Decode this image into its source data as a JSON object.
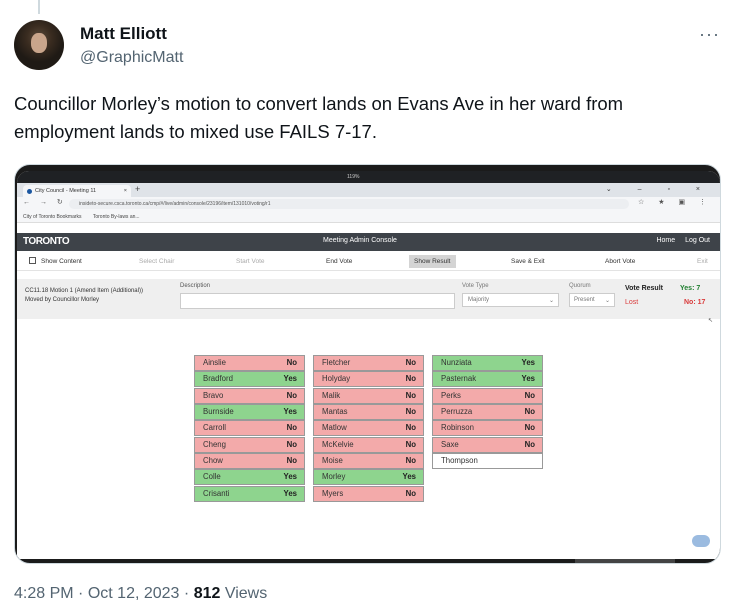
{
  "tweet": {
    "author_name": "Matt Elliott",
    "handle": "@GraphicMatt",
    "more_label": "···",
    "text": "Councillor Morley’s motion to convert lands on Evans Ave in her ward from employment lands to mixed use FAILS 7-17.",
    "time": "4:28 PM",
    "separator": "·",
    "date": "Oct 12, 2023",
    "views_count": "812",
    "views_label": "Views"
  },
  "browser": {
    "tab_label": "City Council - Meeting 11",
    "zoom": "119%",
    "url": "insideto-secure.csca.toronto.ca/cmp/#/live/admin/console/23196/item/131010/voting/r1",
    "bookmarks": [
      "City of Toronto Bookmarks",
      "Toronto By-laws an..."
    ]
  },
  "app": {
    "logo": "TORONTO",
    "title": "Meeting Admin Console",
    "links": [
      "Home",
      "Log Out"
    ],
    "toolbar": {
      "show_content": "Show Content",
      "select_chair": "Select Chair",
      "start_vote": "Start Vote",
      "end_vote": "End Vote",
      "show_result": "Show Result",
      "save_exit": "Save & Exit",
      "abort_vote": "Abort Vote",
      "exit": "Exit"
    },
    "motion": {
      "id_line": "CC11.18 Motion 1 (Amend Item (Additional))",
      "moved_by": "Moved by Councillor Morley",
      "description_label": "Description",
      "vote_type_label": "Vote Type",
      "vote_type_value": "Majority",
      "quorum_label": "Quorum",
      "quorum_value": "Present",
      "vote_result_label": "Vote Result",
      "status": "Lost",
      "yes": "Yes: 7",
      "no": "No: 17"
    }
  },
  "votes": {
    "col1": [
      {
        "name": "Ainslie",
        "vote": "No"
      },
      {
        "name": "Bradford",
        "vote": "Yes"
      },
      {
        "name": "Bravo",
        "vote": "No"
      },
      {
        "name": "Burnside",
        "vote": "Yes"
      },
      {
        "name": "Carroll",
        "vote": "No"
      },
      {
        "name": "Cheng",
        "vote": "No"
      },
      {
        "name": "Chow",
        "vote": "No"
      },
      {
        "name": "Colle",
        "vote": "Yes"
      },
      {
        "name": "Crisanti",
        "vote": "Yes"
      }
    ],
    "col2": [
      {
        "name": "Fletcher",
        "vote": "No"
      },
      {
        "name": "Holyday",
        "vote": "No"
      },
      {
        "name": "Malik",
        "vote": "No"
      },
      {
        "name": "Mantas",
        "vote": "No"
      },
      {
        "name": "Matlow",
        "vote": "No"
      },
      {
        "name": "McKelvie",
        "vote": "No"
      },
      {
        "name": "Moise",
        "vote": "No"
      },
      {
        "name": "Morley",
        "vote": "Yes"
      },
      {
        "name": "Myers",
        "vote": "No"
      }
    ],
    "col3": [
      {
        "name": "Nunziata",
        "vote": "Yes"
      },
      {
        "name": "Pasternak",
        "vote": "Yes"
      },
      {
        "name": "Perks",
        "vote": "No"
      },
      {
        "name": "Perruzza",
        "vote": "No"
      },
      {
        "name": "Robinson",
        "vote": "No"
      },
      {
        "name": "Saxe",
        "vote": "No"
      },
      {
        "name": "Thompson",
        "vote": ""
      }
    ]
  },
  "colors": {
    "yes_fill": "#8ed48e",
    "no_fill": "#f3aaaa",
    "lost_red": "#d93a3a",
    "yes_green": "#1e7e2e"
  }
}
